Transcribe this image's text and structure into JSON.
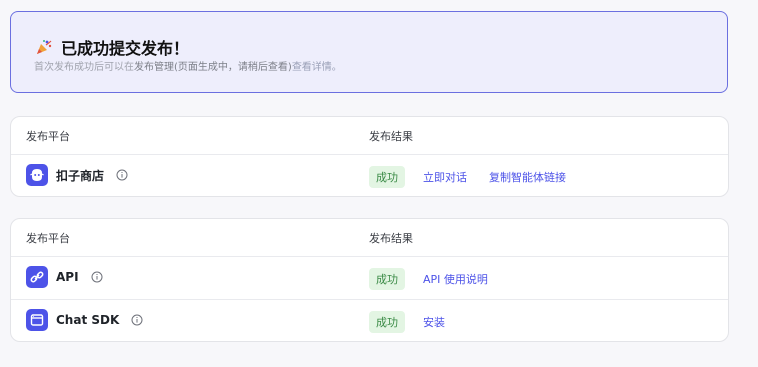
{
  "banner": {
    "title": "已成功提交发布！",
    "desc_prefix": "首次发布成功后可以在",
    "desc_middle": "发布管理(页面生成中，请稍后查看)",
    "desc_link": "查看详情。"
  },
  "card1": {
    "header": {
      "col_platform": "发布平台",
      "col_result": "发布结果"
    },
    "rows": [
      {
        "name": "扣子商店",
        "icon": "coze-store-icon",
        "status": "成功",
        "actions": [
          "立即对话",
          "复制智能体链接"
        ]
      }
    ]
  },
  "card2": {
    "header": {
      "col_platform": "发布平台",
      "col_result": "发布结果"
    },
    "rows": [
      {
        "name": "API",
        "icon": "api-link-icon",
        "status": "成功",
        "actions": [
          "API 使用说明"
        ]
      },
      {
        "name": "Chat SDK",
        "icon": "chat-sdk-window-icon",
        "status": "成功",
        "actions": [
          "安装"
        ]
      }
    ]
  },
  "colors": {
    "accent": "#4d53e8",
    "success_bg": "#e3f5e3",
    "success_text": "#3a8a45",
    "banner_border": "#6b6fe0"
  }
}
